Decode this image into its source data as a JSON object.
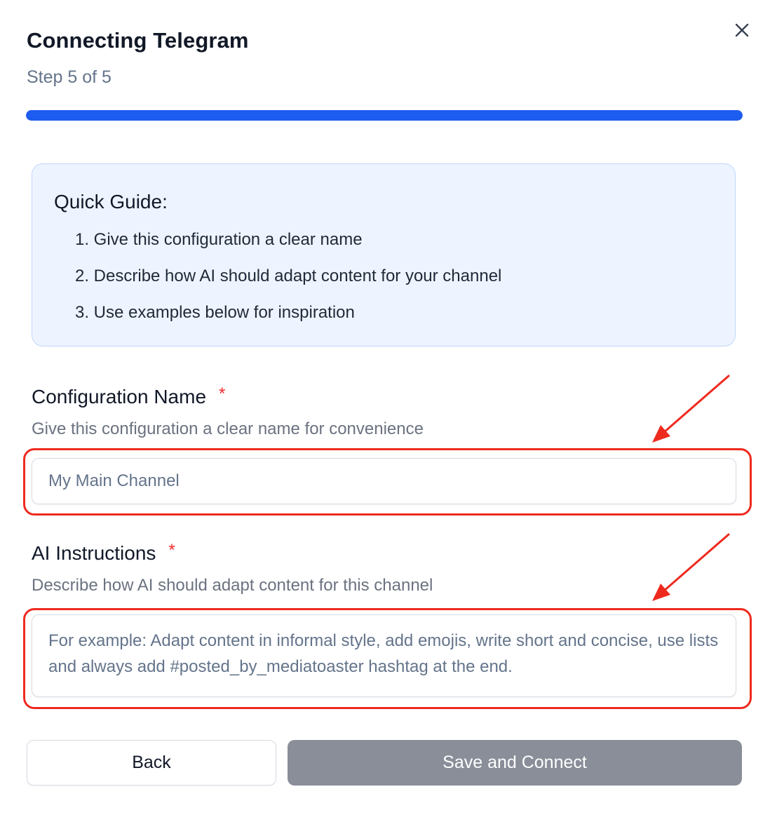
{
  "dialog": {
    "title": "Connecting Telegram",
    "step": "Step 5 of 5",
    "close_icon": "close-icon",
    "progress_percent": 100,
    "progress_color": "#1d5cf0"
  },
  "guide": {
    "title": "Quick Guide:",
    "items": [
      "1. Give this configuration a clear name",
      "2. Describe how AI should adapt content for your channel",
      "3. Use examples below for inspiration"
    ]
  },
  "config_name": {
    "label": "Configuration Name",
    "required_mark": "*",
    "hint": "Give this configuration a clear name for convenience",
    "placeholder": "My Main Channel",
    "value": ""
  },
  "ai_instructions": {
    "label": "AI Instructions",
    "required_mark": "*",
    "hint": "Describe how AI should adapt content for this channel",
    "placeholder": "For example: Adapt content in informal style, add emojis, write short and concise, use lists and always add #posted_by_mediatoaster hashtag at the end.",
    "value": ""
  },
  "actions": {
    "back_label": "Back",
    "save_label": "Save and Connect"
  },
  "annotations": {
    "highlight_color": "#ee2a1f",
    "arrow_icon": "red-arrow-icon"
  }
}
